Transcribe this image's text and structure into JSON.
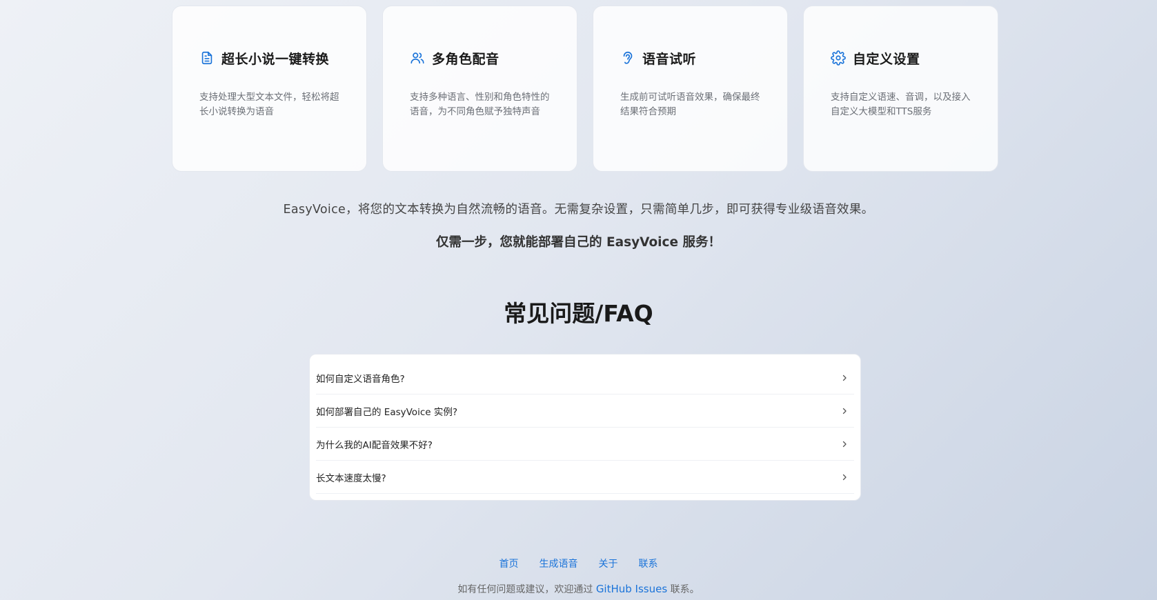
{
  "features": [
    {
      "icon": "document-icon",
      "title": "超长小说一键转换",
      "desc": "支持处理大型文本文件，轻松将超长小说转换为语音"
    },
    {
      "icon": "users-icon",
      "title": "多角色配音",
      "desc": "支持多种语言、性别和角色特性的语音，为不同角色赋予独特声音"
    },
    {
      "icon": "ear-icon",
      "title": "语音试听",
      "desc": "生成前可试听语音效果，确保最终结果符合预期"
    },
    {
      "icon": "gear-icon",
      "title": "自定义设置",
      "desc": "支持自定义语速、音调，以及接入自定义大模型和TTS服务"
    }
  ],
  "intro": "EasyVoice，将您的文本转换为自然流畅的语音。无需复杂设置，只需简单几步，即可获得专业级语音效果。",
  "intro_strong": "仅需一步，您就能部署自己的 EasyVoice 服务！",
  "faq": {
    "title": "常见问题/FAQ",
    "items": [
      {
        "question": "如何自定义语音角色?"
      },
      {
        "question": "如何部署自己的 EasyVoice 实例?"
      },
      {
        "question": "为什么我的AI配音效果不好?"
      },
      {
        "question": "长文本速度太慢?"
      }
    ]
  },
  "footer": {
    "links": [
      "首页",
      "生成语音",
      "关于",
      "联系"
    ],
    "note_prefix": "如有任何问题或建议，欢迎通过",
    "note_link": "GitHub Issues",
    "note_suffix": "联系。"
  },
  "colors": {
    "accent": "#1a73d9",
    "icon": "#1a73d9"
  }
}
